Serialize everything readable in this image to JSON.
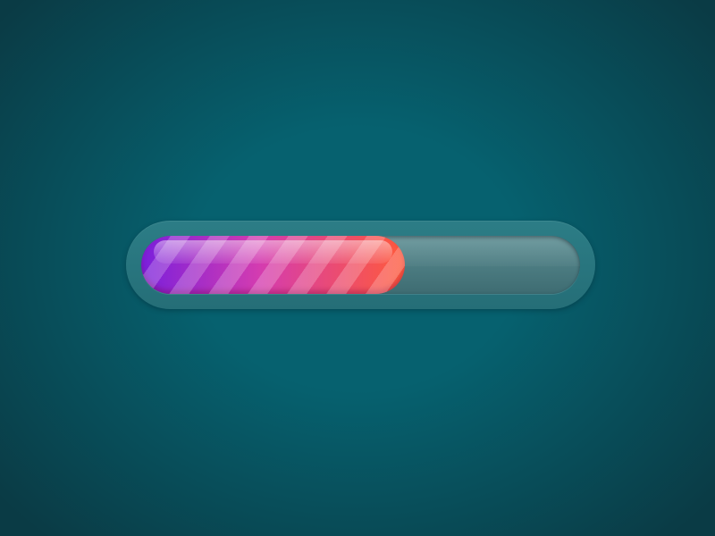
{
  "progress": {
    "value": 0.6,
    "label": ""
  },
  "colors": {
    "background_center": "#06616f",
    "background_edge": "#0a3b45",
    "shell": "#2c7d86",
    "track": "#5b8d92",
    "track_dark": "#3e6c72",
    "fill_start": "#7a1fdc",
    "fill_mid": "#d43cb0",
    "fill_end": "#ff5a3a",
    "fill_highlight": "#ff9a7a"
  },
  "icons": {}
}
